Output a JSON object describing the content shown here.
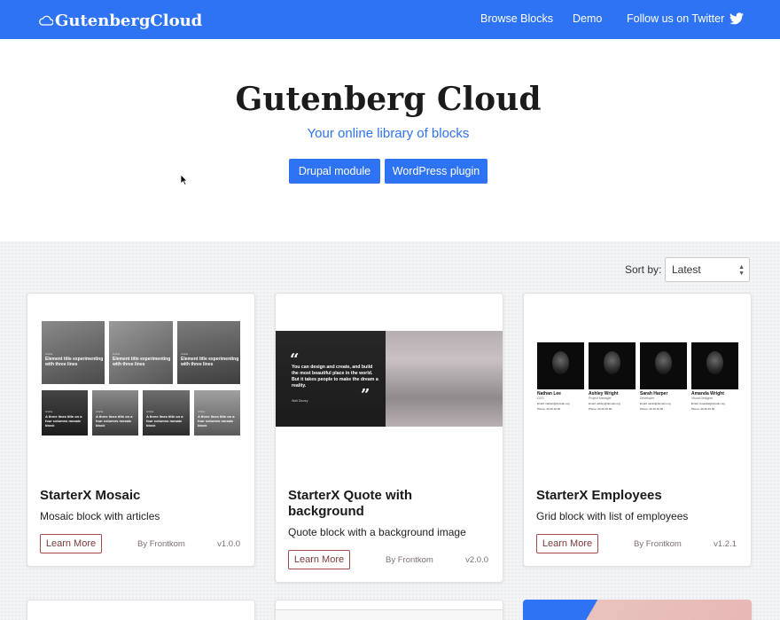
{
  "header": {
    "logo_text": "GutenbergCloud",
    "nav": {
      "browse": "Browse Blocks",
      "demo": "Demo",
      "twitter": "Follow us on Twitter"
    }
  },
  "hero": {
    "title": "Gutenberg Cloud",
    "subtitle": "Your online library of blocks",
    "buttons": {
      "drupal": "Drupal module",
      "wordpress": "WordPress plugin"
    }
  },
  "sort": {
    "label": "Sort by:",
    "selected": "Latest"
  },
  "cards": [
    {
      "title": "StarterX Mosaic",
      "description": "Mosaic block with articles",
      "learn_more": "Learn More",
      "byline": "By Frontkom",
      "version": "v1.0.0",
      "thumb": {
        "top_items": [
          {
            "tag": "Article",
            "text": "Element title experimenting with three lines"
          },
          {
            "tag": "Article",
            "text": "Element title experimenting with three lines"
          },
          {
            "tag": "Article",
            "text": "Element title experimenting with three lines"
          }
        ],
        "bottom_items": [
          {
            "tag": "Article",
            "text": "A three lines title on a four columns mosaic block"
          },
          {
            "tag": "Article",
            "text": "A three lines title on a four columns mosaic block"
          },
          {
            "tag": "Article",
            "text": "A three lines title on a four columns mosaic block"
          },
          {
            "tag": "Article",
            "text": "A three lines title on a four columns mosaic block"
          }
        ]
      }
    },
    {
      "title": "StarterX Quote with background",
      "description": "Quote block with a background image",
      "learn_more": "Learn More",
      "byline": "By Frontkom",
      "version": "v2.0.0",
      "thumb": {
        "quote": "You can design and create, and build the most beautiful place in the world. But it takes people to make the dream a reality.",
        "author": "Walt Disney"
      }
    },
    {
      "title": "StarterX Employees",
      "description": "Grid block with list of employees",
      "learn_more": "Learn More",
      "byline": "By Frontkom",
      "version": "v1.2.1",
      "thumb": {
        "employees": [
          {
            "name": "Nathan Lee",
            "role": "CEO",
            "email": "Email: nathan@domain.org",
            "phone": "Phone: 20 40 20 50"
          },
          {
            "name": "Ashley Wright",
            "role": "Project Manager",
            "email": "Email: ashley@domain.org",
            "phone": "Phone: 20 40 20 50"
          },
          {
            "name": "Sarah Harper",
            "role": "Developer",
            "email": "Email: sarah@domain.org",
            "phone": "Phone: 20 40 20 50"
          },
          {
            "name": "Amanda Wright",
            "role": "Visual Designer",
            "email": "Email: amanda@domain.org",
            "phone": "Phone: 20 40 20 50"
          }
        ]
      }
    }
  ],
  "colors": {
    "brand_blue": "#2e73f4",
    "learn_more_border": "#a44a4a"
  },
  "icons": {
    "logo": "cloud-icon",
    "twitter": "twitter-bird-icon",
    "sort": "select-arrows-icon",
    "pointer": "mouse-cursor-icon"
  }
}
